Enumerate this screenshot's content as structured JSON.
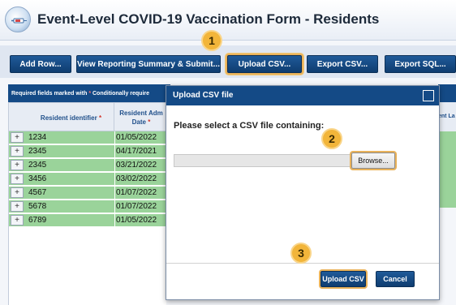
{
  "header": {
    "title": "Event-Level COVID-19 Vaccination Form - Residents",
    "logo_icon": "syringe-logo-icon"
  },
  "toolbar": {
    "add_row": "Add Row...",
    "view_summary": "View Reporting Summary & Submit...",
    "upload_csv": "Upload CSV...",
    "export_csv": "Export CSV...",
    "export_sql": "Export SQL..."
  },
  "grid": {
    "note": "Required fields marked with",
    "note_tail": "Conditionally require",
    "req_mark": "*",
    "col_resident": "Resident identifier",
    "col_admission_l1": "Resident Adm",
    "col_admission_l2": "Date",
    "right_col": "ent La",
    "rows": [
      {
        "plus": "+",
        "id": "1234",
        "date": "01/05/2022"
      },
      {
        "plus": "+",
        "id": "2345",
        "date": "04/17/2021"
      },
      {
        "plus": "+",
        "id": "2345",
        "date": "03/21/2022"
      },
      {
        "plus": "+",
        "id": "3456",
        "date": "03/02/2022"
      },
      {
        "plus": "+",
        "id": "4567",
        "date": "01/07/2022"
      },
      {
        "plus": "+",
        "id": "5678",
        "date": "01/07/2022"
      },
      {
        "plus": "+",
        "id": "6789",
        "date": "01/05/2022"
      }
    ]
  },
  "dialog": {
    "title": "Upload CSV file",
    "prompt": "Please select a CSV file containing:",
    "file_value": "",
    "browse": "Browse...",
    "upload": "Upload CSV",
    "cancel": "Cancel"
  },
  "callouts": {
    "one": "1",
    "two": "2",
    "three": "3"
  },
  "colors": {
    "accent": "#144a86",
    "highlight": "#f2b53a",
    "row_green": "#9ad39a"
  }
}
